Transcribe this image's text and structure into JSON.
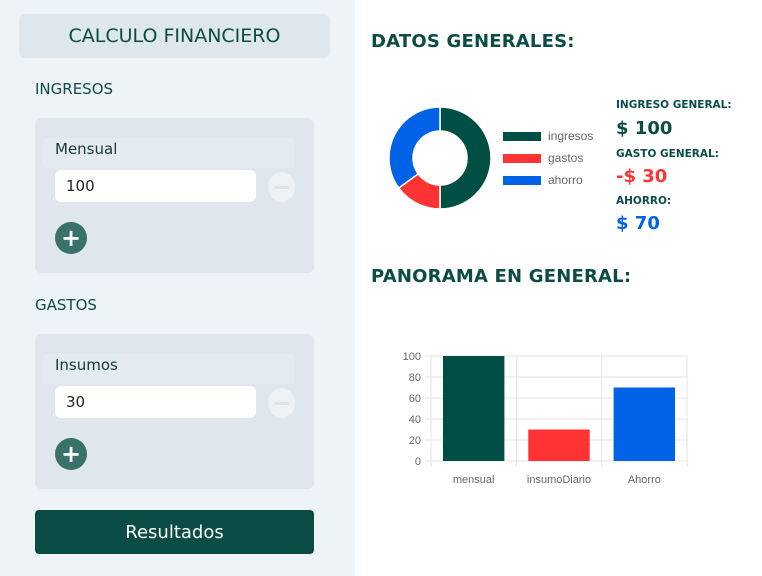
{
  "app": {
    "title": "CALCULO FINANCIERO",
    "results_button": "Resultados"
  },
  "income": {
    "section_label": "INGRESOS",
    "item_label": "Mensual",
    "value": "100",
    "remove_icon": "minus-circle-icon",
    "add_icon": "plus-circle-icon"
  },
  "expenses": {
    "section_label": "GASTOS",
    "item_label": "Insumos",
    "value": "30",
    "remove_icon": "minus-circle-icon",
    "add_icon": "plus-circle-icon"
  },
  "general": {
    "heading": "DATOS GENERALES:",
    "income_label": "INGRESO GENERAL:",
    "income_value": "$ 100",
    "expense_label": "GASTO GENERAL:",
    "expense_value": "-$ 30",
    "saving_label": "AHORRO:",
    "saving_value": "$ 70"
  },
  "panorama": {
    "heading": "PANORAMA EN GENERAL:"
  },
  "colors": {
    "brand": "#0b4d44",
    "income": "#004f45",
    "expense": "#ff3333",
    "saving": "#0062e6"
  },
  "chart_data": [
    {
      "type": "pie",
      "labels": [
        "ingresos",
        "gastos",
        "ahorro"
      ],
      "values": [
        100,
        30,
        70
      ],
      "colors": [
        "#004f45",
        "#ff3333",
        "#0062e6"
      ],
      "legend": "right",
      "donut": true
    },
    {
      "type": "bar",
      "categories": [
        "mensual",
        "insumoDiario",
        "Ahorro"
      ],
      "values": [
        100,
        30,
        70
      ],
      "colors": [
        "#004f45",
        "#ff3333",
        "#0062e6"
      ],
      "ylim": [
        0,
        100
      ],
      "yticks": [
        0,
        20,
        40,
        60,
        80,
        100
      ],
      "grid": true,
      "legend": "none"
    }
  ]
}
